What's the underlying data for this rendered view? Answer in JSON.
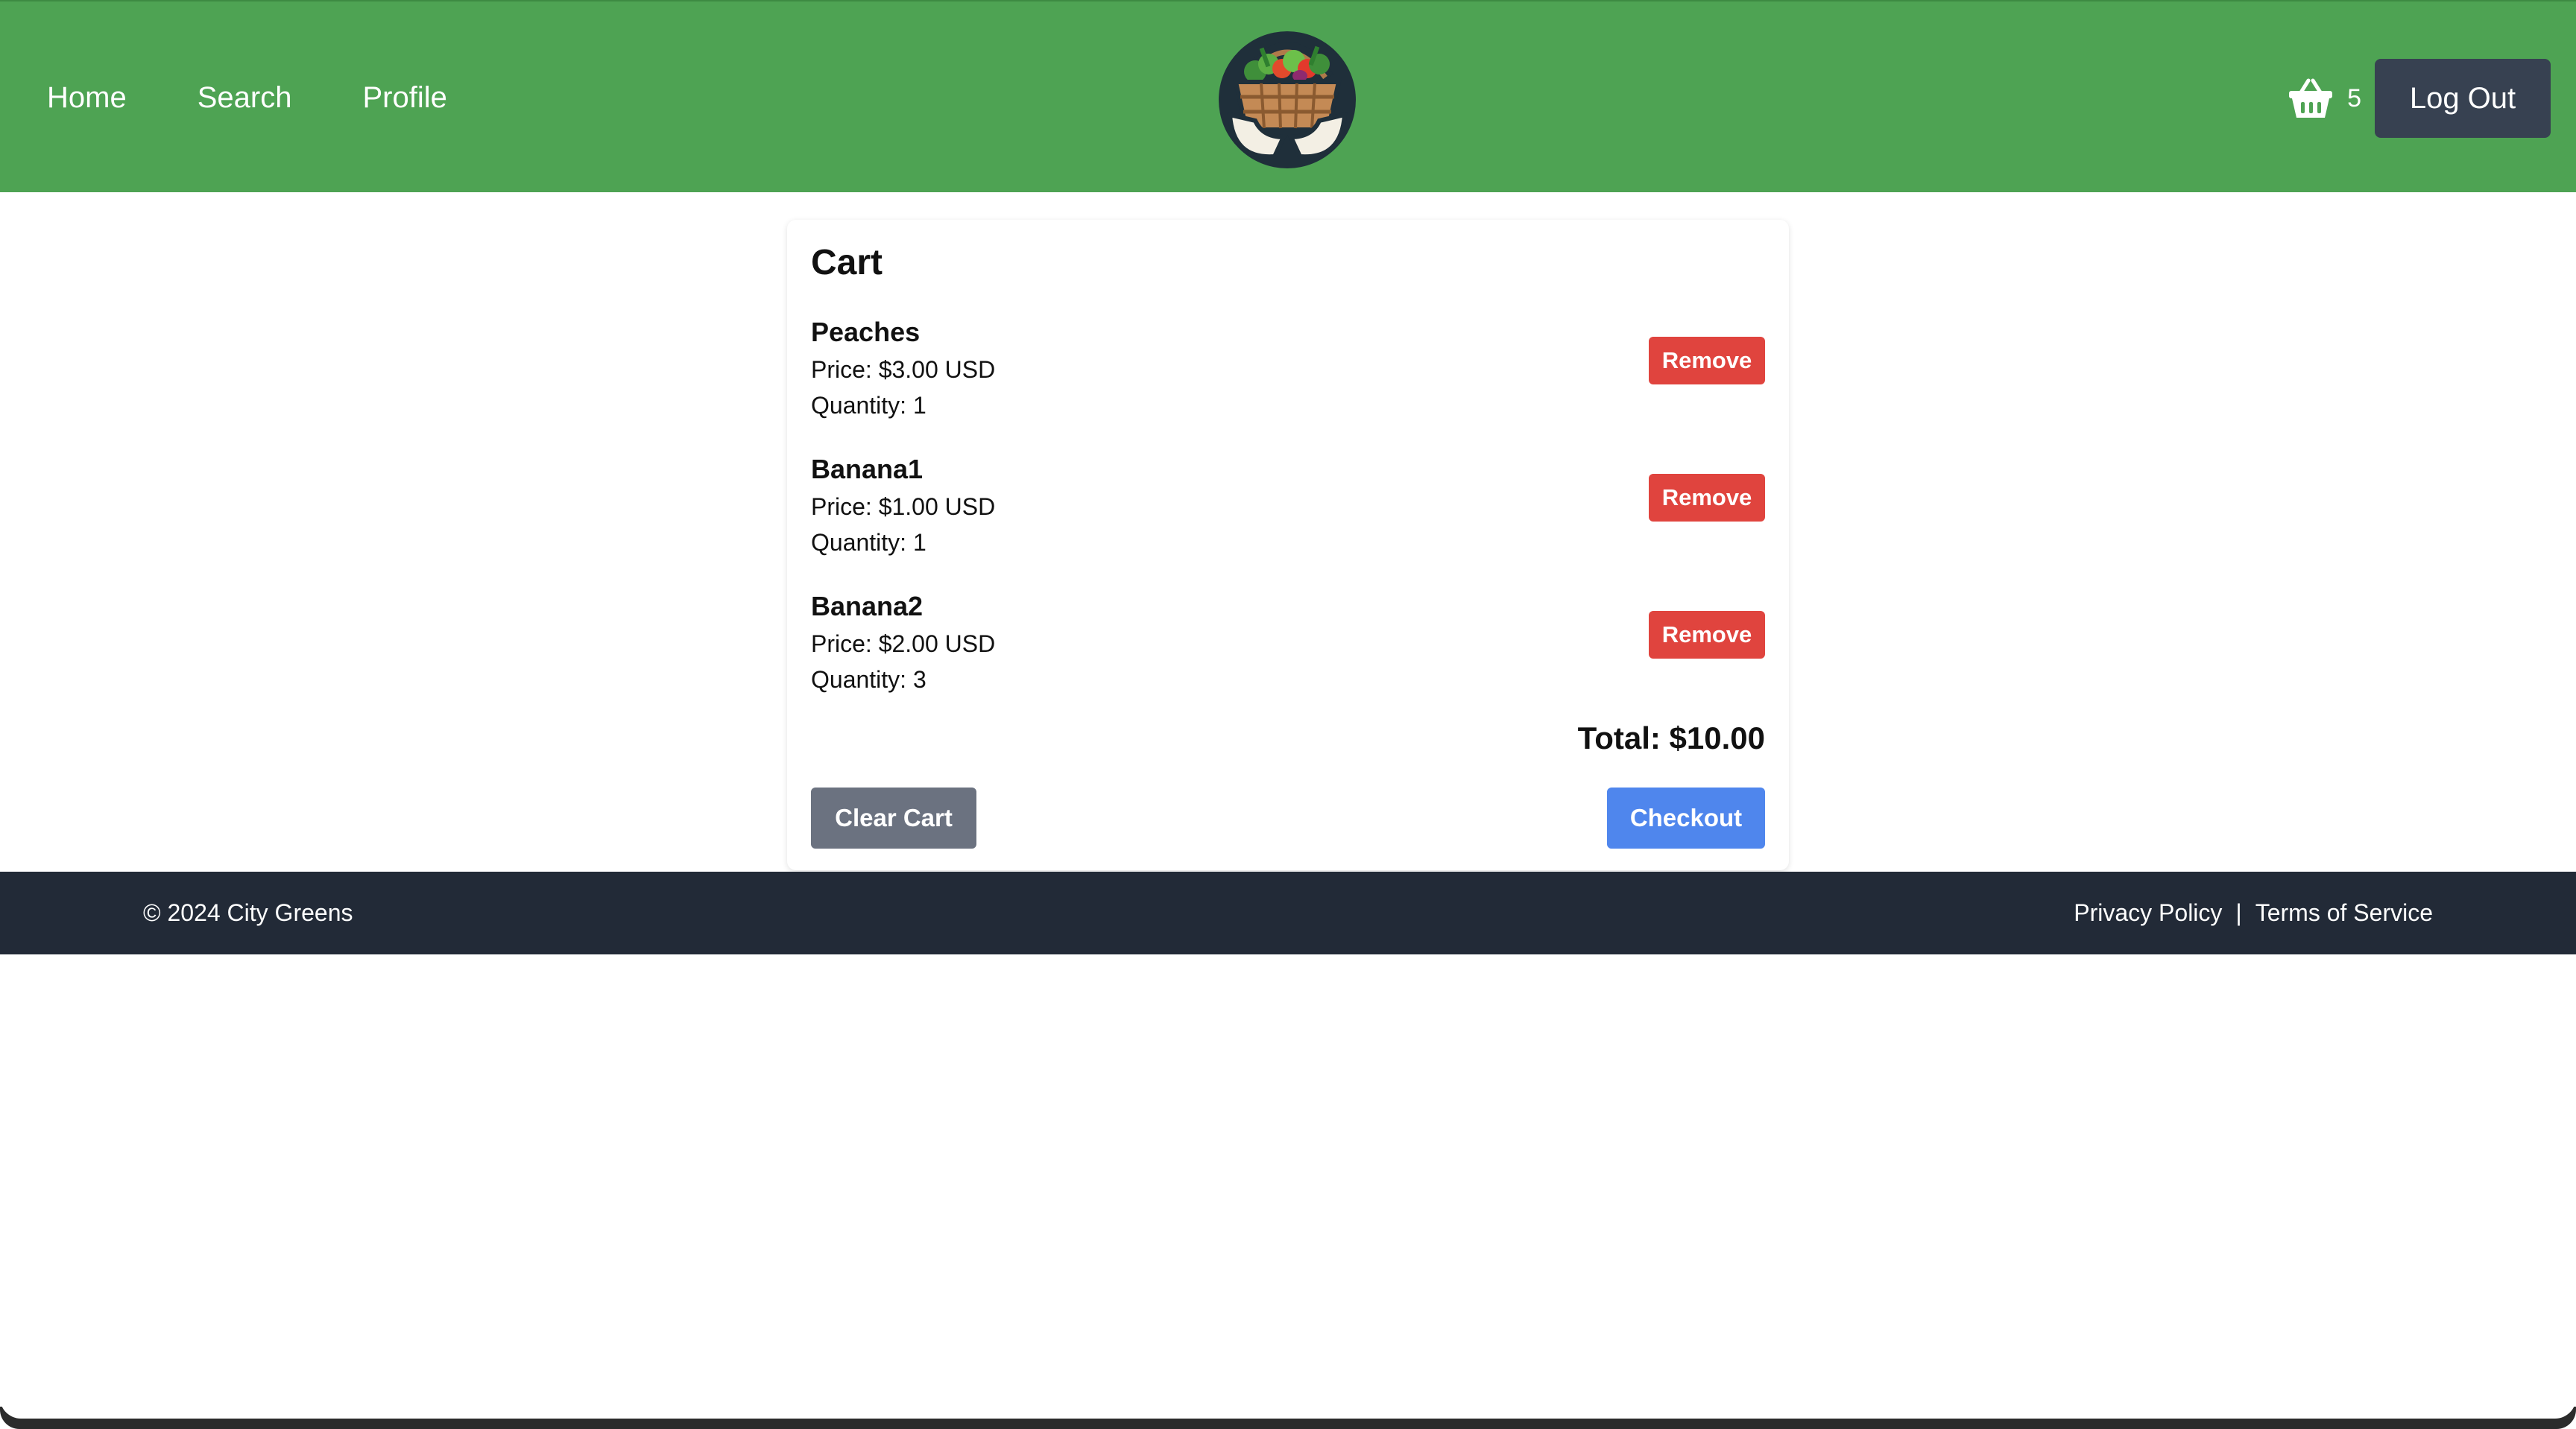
{
  "nav": {
    "home": "Home",
    "search": "Search",
    "profile": "Profile"
  },
  "header": {
    "logo_icon": "vegetable-basket-logo",
    "cart_icon": "basket-icon",
    "cart_count": "5",
    "logout_label": "Log Out"
  },
  "cart": {
    "title": "Cart",
    "items": [
      {
        "name": "Peaches",
        "price": "Price: $3.00 USD",
        "quantity": "Quantity: 1",
        "remove_label": "Remove"
      },
      {
        "name": "Banana1",
        "price": "Price: $1.00 USD",
        "quantity": "Quantity: 1",
        "remove_label": "Remove"
      },
      {
        "name": "Banana2",
        "price": "Price: $2.00 USD",
        "quantity": "Quantity: 3",
        "remove_label": "Remove"
      }
    ],
    "total": "Total: $10.00",
    "clear_label": "Clear Cart",
    "checkout_label": "Checkout"
  },
  "footer": {
    "copyright": "© 2024 City Greens",
    "privacy": "Privacy Policy",
    "separator": "|",
    "terms": "Terms of Service"
  },
  "colors": {
    "header_green": "#4ea353",
    "logout_bg": "#374151",
    "remove_red": "#e0443e",
    "clear_gray": "#6b7280",
    "checkout_blue": "#4f86ed",
    "footer_bg": "#222a37"
  }
}
